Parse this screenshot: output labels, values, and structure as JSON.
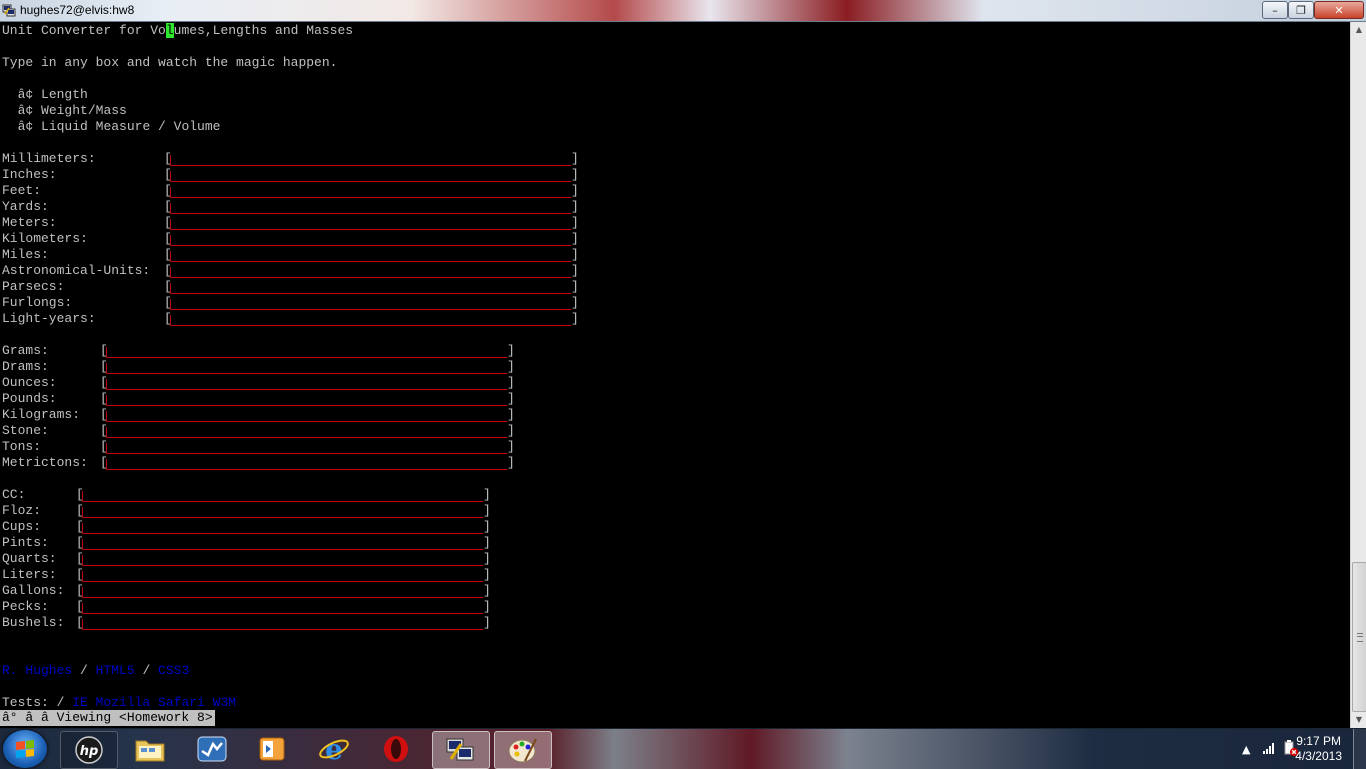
{
  "window": {
    "title": "hughes72@elvis:hw8",
    "minimize": "–",
    "maximize": "❐",
    "close": "✕"
  },
  "terminal": {
    "heading_before": "Unit Converter for Vo",
    "heading_cursor_char": "l",
    "heading_after": "umes,Lengths and Masses",
    "intro": "Type in any box and watch the magic happen.",
    "bullet_glyph": "â¢",
    "bullets": [
      "Length",
      "Weight/Mass",
      "Liquid Measure / Volume"
    ],
    "length_fields": [
      "Millimeters:",
      "Inches:",
      "Feet:",
      "Yards:",
      "Meters:",
      "Kilometers:",
      "Miles:",
      "Astronomical-Units:",
      "Parsecs:",
      "Furlongs:",
      "Light-years:"
    ],
    "mass_fields": [
      "Grams:",
      "Drams:",
      "Ounces:",
      "Pounds:",
      "Kilograms:",
      "Stone:",
      "Tons:",
      "Metrictons:"
    ],
    "volume_fields": [
      "CC:",
      "Floz:",
      "Cups:",
      "Pints:",
      "Quarts:",
      "Liters:",
      "Gallons:",
      "Pecks:",
      "Bushels:"
    ],
    "bracket_left": "[",
    "bracket_right": "]",
    "footer_links": [
      "R. Hughes",
      "HTML5",
      "CSS3"
    ],
    "footer_sep": " / ",
    "tests_label": "Tests: / ",
    "tests_links": "IE Mozilla Safari W3M",
    "status": "â° â â Viewing <Homework 8>"
  },
  "taskbar": {
    "clock_time": "9:17 PM",
    "clock_date": "4/3/2013"
  },
  "colors": {
    "terminal_text": "#c0c0c0",
    "field_underline": "#c00000",
    "link": "#0000c8",
    "cursor": "#2ee82e"
  }
}
